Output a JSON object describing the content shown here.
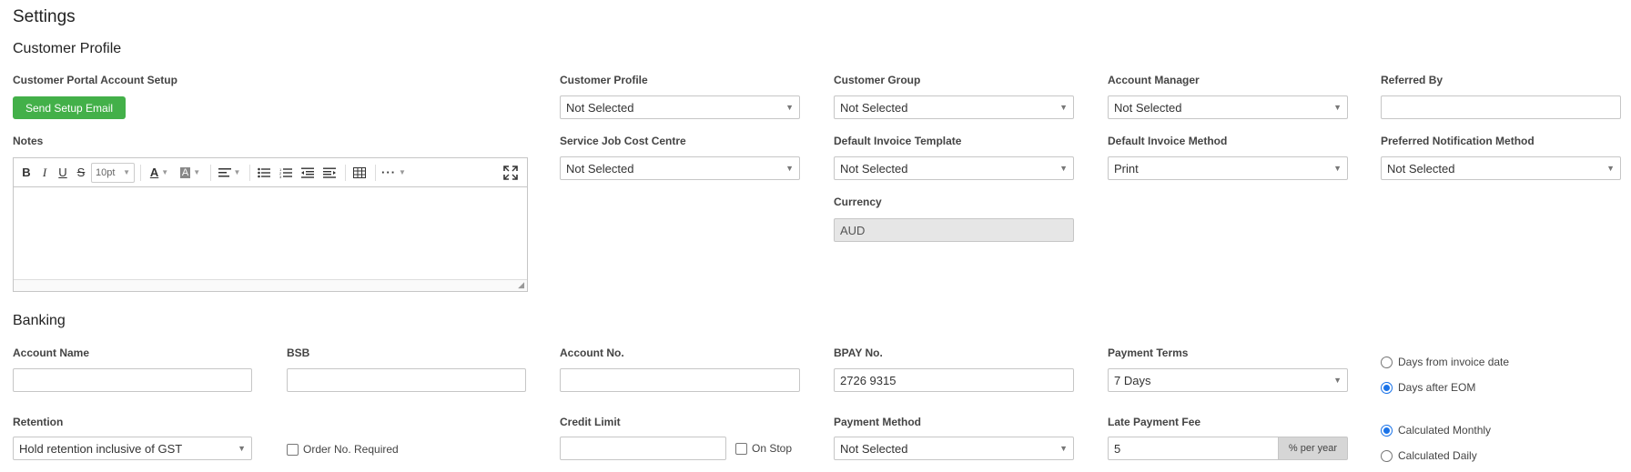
{
  "page": {
    "title": "Settings"
  },
  "customer_profile": {
    "heading": "Customer Profile",
    "portal_label": "Customer Portal Account Setup",
    "send_setup_email": "Send Setup Email",
    "notes_label": "Notes",
    "editor": {
      "font_size": "10pt"
    },
    "fields": {
      "customer_profile": {
        "label": "Customer Profile",
        "value": "Not Selected"
      },
      "customer_group": {
        "label": "Customer Group",
        "value": "Not Selected"
      },
      "account_manager": {
        "label": "Account Manager",
        "value": "Not Selected"
      },
      "referred_by": {
        "label": "Referred By",
        "value": ""
      },
      "service_job_cost_centre": {
        "label": "Service Job Cost Centre",
        "value": "Not Selected"
      },
      "default_invoice_template": {
        "label": "Default Invoice Template",
        "value": "Not Selected"
      },
      "default_invoice_method": {
        "label": "Default Invoice Method",
        "value": "Print"
      },
      "preferred_notification_method": {
        "label": "Preferred Notification Method",
        "value": "Not Selected"
      },
      "currency": {
        "label": "Currency",
        "value": "AUD"
      }
    }
  },
  "banking": {
    "heading": "Banking",
    "account_name": {
      "label": "Account Name",
      "value": ""
    },
    "bsb": {
      "label": "BSB",
      "value": ""
    },
    "account_no": {
      "label": "Account No.",
      "value": ""
    },
    "bpay_no": {
      "label": "BPAY No.",
      "value": "2726 9315"
    },
    "payment_terms": {
      "label": "Payment Terms",
      "value": "7 Days"
    },
    "terms_options": [
      "Days from invoice date",
      "Days after EOM"
    ],
    "terms_selected": 1,
    "retention": {
      "label": "Retention",
      "value": "Hold retention inclusive of GST"
    },
    "order_no_required": {
      "label": "Order No. Required",
      "checked": false
    },
    "credit_limit": {
      "label": "Credit Limit",
      "value": ""
    },
    "on_stop": {
      "label": "On Stop",
      "checked": false
    },
    "payment_method": {
      "label": "Payment Method",
      "value": "Not Selected"
    },
    "late_payment_fee": {
      "label": "Late Payment Fee",
      "value": "5",
      "suffix": "% per year"
    },
    "calc_options": [
      "Calculated Monthly",
      "Calculated Daily"
    ],
    "calc_selected": 0
  },
  "icons": [
    "bold-icon",
    "italic-icon",
    "underline-icon",
    "strikethrough-icon",
    "text-color-icon",
    "highlight-icon",
    "align-icon",
    "bullet-list-icon",
    "numbered-list-icon",
    "outdent-icon",
    "indent-icon",
    "table-icon",
    "more-icon",
    "fullscreen-icon",
    "resize-handle-icon",
    "caret-down-icon"
  ],
  "colors": {
    "primary_button": "#43b049",
    "radio_selected": "#1a73e8",
    "disabled_bg": "#e6e6e6"
  }
}
